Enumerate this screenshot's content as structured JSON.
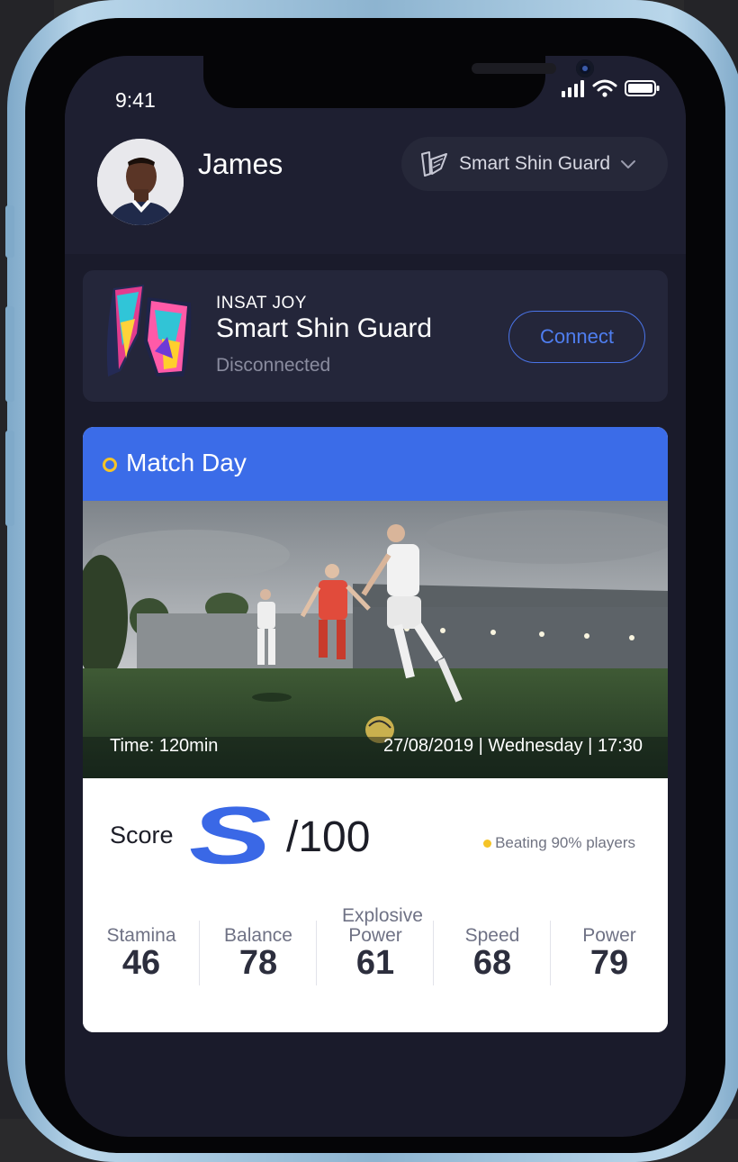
{
  "status_bar": {
    "time": "9:41"
  },
  "user": {
    "name": "James"
  },
  "device_selector": {
    "label": "Smart Shin Guard"
  },
  "device_card": {
    "brand": "INSAT JOY",
    "name": "Smart Shin Guard",
    "status": "Disconnected",
    "connect_label": "Connect"
  },
  "match": {
    "title": "Match Day",
    "time": "Time: 120min",
    "date": "27/08/2019 | Wednesday | 17:30"
  },
  "score": {
    "label": "Score",
    "grade": "S",
    "max": "/100",
    "beating": "Beating 90% players"
  },
  "stats": [
    {
      "label": "Stamina",
      "value": "46"
    },
    {
      "label": "Balance",
      "value": "78"
    },
    {
      "label": "Explosive Power",
      "value": "61"
    },
    {
      "label": "Speed",
      "value": "68"
    },
    {
      "label": "Power",
      "value": "79"
    }
  ],
  "colors": {
    "accent_blue": "#3b6ce8",
    "highlight_yellow": "#f5c427",
    "screen_bg": "#1a1b2b",
    "card_bg": "#24263a"
  }
}
